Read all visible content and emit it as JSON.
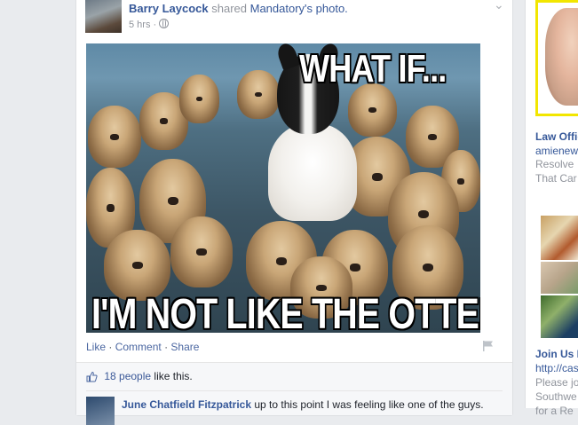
{
  "story": {
    "actor": "Barry Laycock",
    "verb": "shared",
    "page": "Mandatory's photo.",
    "timestamp": "5 hrs",
    "separator": "·",
    "privacy_icon": "globe-icon",
    "menu_icon": "chevron-down-icon",
    "meme_top": "WHAT IF...",
    "meme_bottom": "I'M NOT LIKE THE OTTERS?"
  },
  "actions": {
    "like": "Like",
    "comment": "Comment",
    "share": "Share",
    "sep": "·"
  },
  "likes": {
    "count_text": "18 people",
    "suffix": "like this."
  },
  "comments": [
    {
      "author": "June Chatfield Fitzpatrick",
      "text": "up to this point I was feeling like one of the guys."
    }
  ],
  "rail": {
    "ad1": {
      "title": "Law Offic",
      "url": "amienew",
      "body1": "Resolve",
      "body2": "That Car"
    },
    "ad2": {
      "title": "Join Us I",
      "url": "http://cas",
      "body1": "Please jo",
      "body2": "Southwe",
      "body3": "for a Re"
    }
  },
  "colors": {
    "link": "#365899",
    "background": "#e9ebee",
    "ad_border": "#f2e600"
  }
}
